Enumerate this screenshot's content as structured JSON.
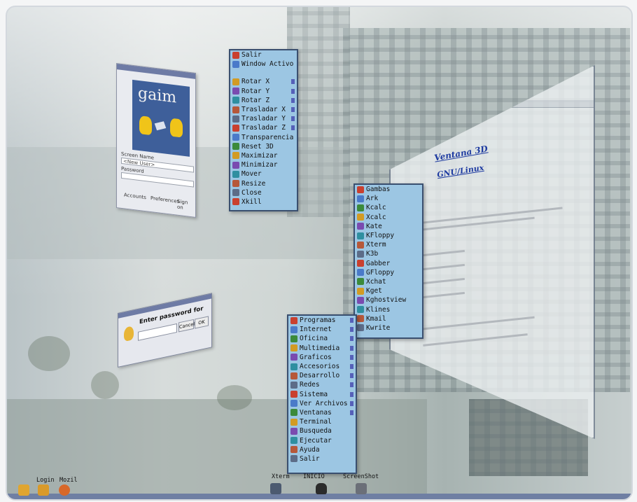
{
  "screen": {
    "accent_color": "#9cc6e3",
    "taskbar_color": "#6f7fa3"
  },
  "gaim_window": {
    "logo_text": "gaim",
    "screen_name_label": "Screen Name",
    "screen_name_value": "<New User>",
    "password_label": "Password",
    "buttons": [
      "Accounts",
      "Preferences",
      "Sign on"
    ]
  },
  "window_menu": {
    "items": [
      {
        "label": "Salir",
        "icon": "exit-icon",
        "arrow": false
      },
      {
        "label": "Window Activo",
        "icon": "window-icon",
        "arrow": false
      },
      {
        "separator": true
      },
      {
        "label": "Rotar X",
        "icon": "rotate-icon",
        "arrow": true
      },
      {
        "label": "Rotar Y",
        "icon": "rotate-icon",
        "arrow": true
      },
      {
        "label": "Rotar Z",
        "icon": "rotate-icon",
        "arrow": true
      },
      {
        "label": "Trasladar X",
        "icon": "move-icon",
        "arrow": true
      },
      {
        "label": "Trasladar Y",
        "icon": "move-icon",
        "arrow": true
      },
      {
        "label": "Trasladar Z",
        "icon": "move-icon",
        "arrow": true
      },
      {
        "label": "Transparencia",
        "icon": "transparency-icon",
        "arrow": false
      },
      {
        "label": "Reset 3D",
        "icon": "reset-icon",
        "arrow": false
      },
      {
        "label": "Maximizar",
        "icon": "maximize-icon",
        "arrow": false
      },
      {
        "label": "Minimizar",
        "icon": "minimize-icon",
        "arrow": false
      },
      {
        "label": "Mover",
        "icon": "move-icon",
        "arrow": false
      },
      {
        "label": "Resize",
        "icon": "resize-icon",
        "arrow": false
      },
      {
        "label": "Close",
        "icon": "close-icon",
        "arrow": false
      },
      {
        "label": "Xkill",
        "icon": "kill-icon",
        "arrow": false
      }
    ]
  },
  "apps_menu": {
    "items": [
      {
        "label": "Gambas",
        "icon": "gambas-icon"
      },
      {
        "label": "Ark",
        "icon": "archive-icon"
      },
      {
        "label": "Kcalc",
        "icon": "calculator-icon"
      },
      {
        "label": "Xcalc",
        "icon": "calculator-icon"
      },
      {
        "label": "Kate",
        "icon": "editor-icon"
      },
      {
        "label": "KFloppy",
        "icon": "floppy-icon"
      },
      {
        "label": "Xterm",
        "icon": "terminal-icon"
      },
      {
        "label": "K3b",
        "icon": "disc-icon"
      },
      {
        "label": "Gabber",
        "icon": "chat-icon"
      },
      {
        "label": "GFloppy",
        "icon": "floppy-icon"
      },
      {
        "label": "Xchat",
        "icon": "chat-icon"
      },
      {
        "label": "Kget",
        "icon": "download-icon"
      },
      {
        "label": "Kghostview",
        "icon": "viewer-icon"
      },
      {
        "label": "Klines",
        "icon": "game-icon"
      },
      {
        "label": "Kmail",
        "icon": "mail-icon"
      },
      {
        "label": "Kwrite",
        "icon": "editor-icon"
      }
    ]
  },
  "start_menu": {
    "items": [
      {
        "label": "Programas",
        "icon": "programs-icon",
        "arrow": true
      },
      {
        "label": "Internet",
        "icon": "internet-icon",
        "arrow": true
      },
      {
        "label": "Oficina",
        "icon": "office-icon",
        "arrow": true
      },
      {
        "label": "Multimedia",
        "icon": "multimedia-icon",
        "arrow": true
      },
      {
        "label": "Graficos",
        "icon": "graphics-icon",
        "arrow": true
      },
      {
        "label": "Accesorios",
        "icon": "accessories-icon",
        "arrow": true
      },
      {
        "label": "Desarrollo",
        "icon": "development-icon",
        "arrow": true
      },
      {
        "label": "Redes",
        "icon": "network-icon",
        "arrow": true
      },
      {
        "label": "Sistema",
        "icon": "system-icon",
        "arrow": true
      },
      {
        "label": "Ver Archivos",
        "icon": "files-icon",
        "arrow": true
      },
      {
        "label": "Ventanas",
        "icon": "windows-icon",
        "arrow": true
      },
      {
        "label": "Terminal",
        "icon": "terminal-icon",
        "arrow": false
      },
      {
        "label": "Busqueda",
        "icon": "search-icon",
        "arrow": false
      },
      {
        "label": "Ejecutar",
        "icon": "run-icon",
        "arrow": false
      },
      {
        "label": "Ayuda",
        "icon": "help-icon",
        "arrow": false
      },
      {
        "label": "Salir",
        "icon": "exit-icon",
        "arrow": false
      }
    ]
  },
  "browser_window": {
    "heading": "Ventana 3D",
    "subheading": "GNU/Linux"
  },
  "password_dialog": {
    "title": "Enter password for",
    "cancel_label": "Cancel",
    "ok_label": "OK"
  },
  "launchers": {
    "left": [
      {
        "label": "Login",
        "icon": "login-icon"
      },
      {
        "label": "Mozil",
        "icon": "mozilla-icon"
      }
    ],
    "center": [
      {
        "label": "Xterm",
        "icon": "terminal-icon"
      },
      {
        "label": "INICIO",
        "icon": "start-icon"
      },
      {
        "label": "ScreenShot",
        "icon": "screenshot-icon"
      }
    ]
  }
}
